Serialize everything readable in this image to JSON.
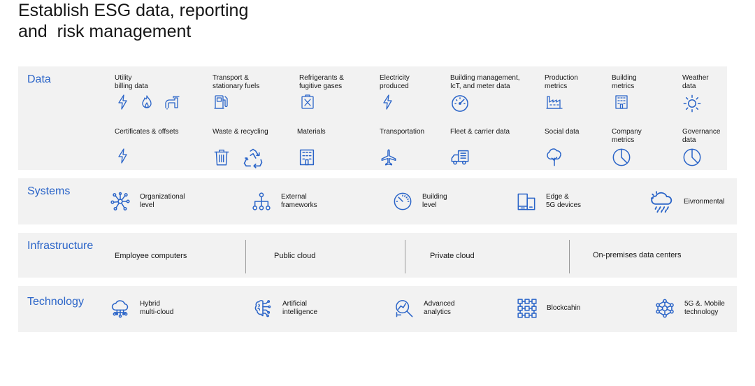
{
  "title": {
    "line1": "Establish ESG data, reporting",
    "line2": "and  risk management"
  },
  "colors": {
    "accent": "#2a64c8",
    "band": "#f2f2f2"
  },
  "data_section": {
    "label": "Data",
    "row1": [
      {
        "label": "Utility\nbilling data",
        "icons": [
          "lightning-icon",
          "flame-icon",
          "faucet-icon"
        ]
      },
      {
        "label": "Transport &\nstationary fuels",
        "icons": [
          "fuel-pump-icon"
        ]
      },
      {
        "label": "Refrigerants &\nfugitive gases",
        "icons": [
          "gas-container-icon"
        ]
      },
      {
        "label": "Electricity\nproduced",
        "icons": [
          "lightning-icon"
        ]
      },
      {
        "label": "Building management,\nIcT, and meter data",
        "icons": [
          "meter-gauge-icon"
        ]
      },
      {
        "label": "Production\nmetrics",
        "icons": [
          "factory-icon"
        ]
      },
      {
        "label": "Building\nmetrics",
        "icons": [
          "building-icon"
        ]
      },
      {
        "label": "Weather\ndata",
        "icons": [
          "sun-icon"
        ]
      }
    ],
    "row2": [
      {
        "label": "Certificates & offsets",
        "icons": [
          "lightning-icon"
        ]
      },
      {
        "label": "Waste & recycling",
        "icons": [
          "trash-can-icon",
          "recycle-icon"
        ]
      },
      {
        "label": "Materials",
        "icons": [
          "building-icon"
        ]
      },
      {
        "label": "Transportation",
        "icons": [
          "airplane-icon"
        ]
      },
      {
        "label": "Fleet & carrier data",
        "icons": [
          "delivery-truck-icon"
        ]
      },
      {
        "label": "Social data",
        "icons": [
          "tree-icon"
        ]
      },
      {
        "label": "Company\nmetrics",
        "icons": [
          "pie-chart-icon"
        ]
      },
      {
        "label": "Governance\ndata",
        "icons": [
          "pie-chart-icon"
        ]
      }
    ]
  },
  "systems": {
    "label": "Systems",
    "items": [
      {
        "label": "Organizational\nlevel",
        "icon": "network-icon"
      },
      {
        "label": "External\nframeworks",
        "icon": "hierarchy-icon"
      },
      {
        "label": "Building\nlevel",
        "icon": "gauge-icon"
      },
      {
        "label": "Edge &\n5G devices",
        "icon": "devices-icon"
      },
      {
        "label": "Eivronmental",
        "icon": "weather-storm-icon"
      }
    ]
  },
  "infrastructure": {
    "label": "Infrastructure",
    "items": [
      "Employee computers",
      "Public cloud",
      "Private cloud",
      "On-premises data centers"
    ]
  },
  "technology": {
    "label": "Technology",
    "items": [
      {
        "label": "Hybrid\nmulti-cloud",
        "icon": "cloud-network-icon"
      },
      {
        "label": "Artificial\nintelligence",
        "icon": "brain-circuit-icon"
      },
      {
        "label": "Advanced\nanalytics",
        "icon": "analytics-icon"
      },
      {
        "label": "Blockcahin",
        "icon": "blockchain-icon"
      },
      {
        "label": "5G &. Mobile\ntechnology",
        "icon": "mobile-network-icon"
      }
    ]
  }
}
